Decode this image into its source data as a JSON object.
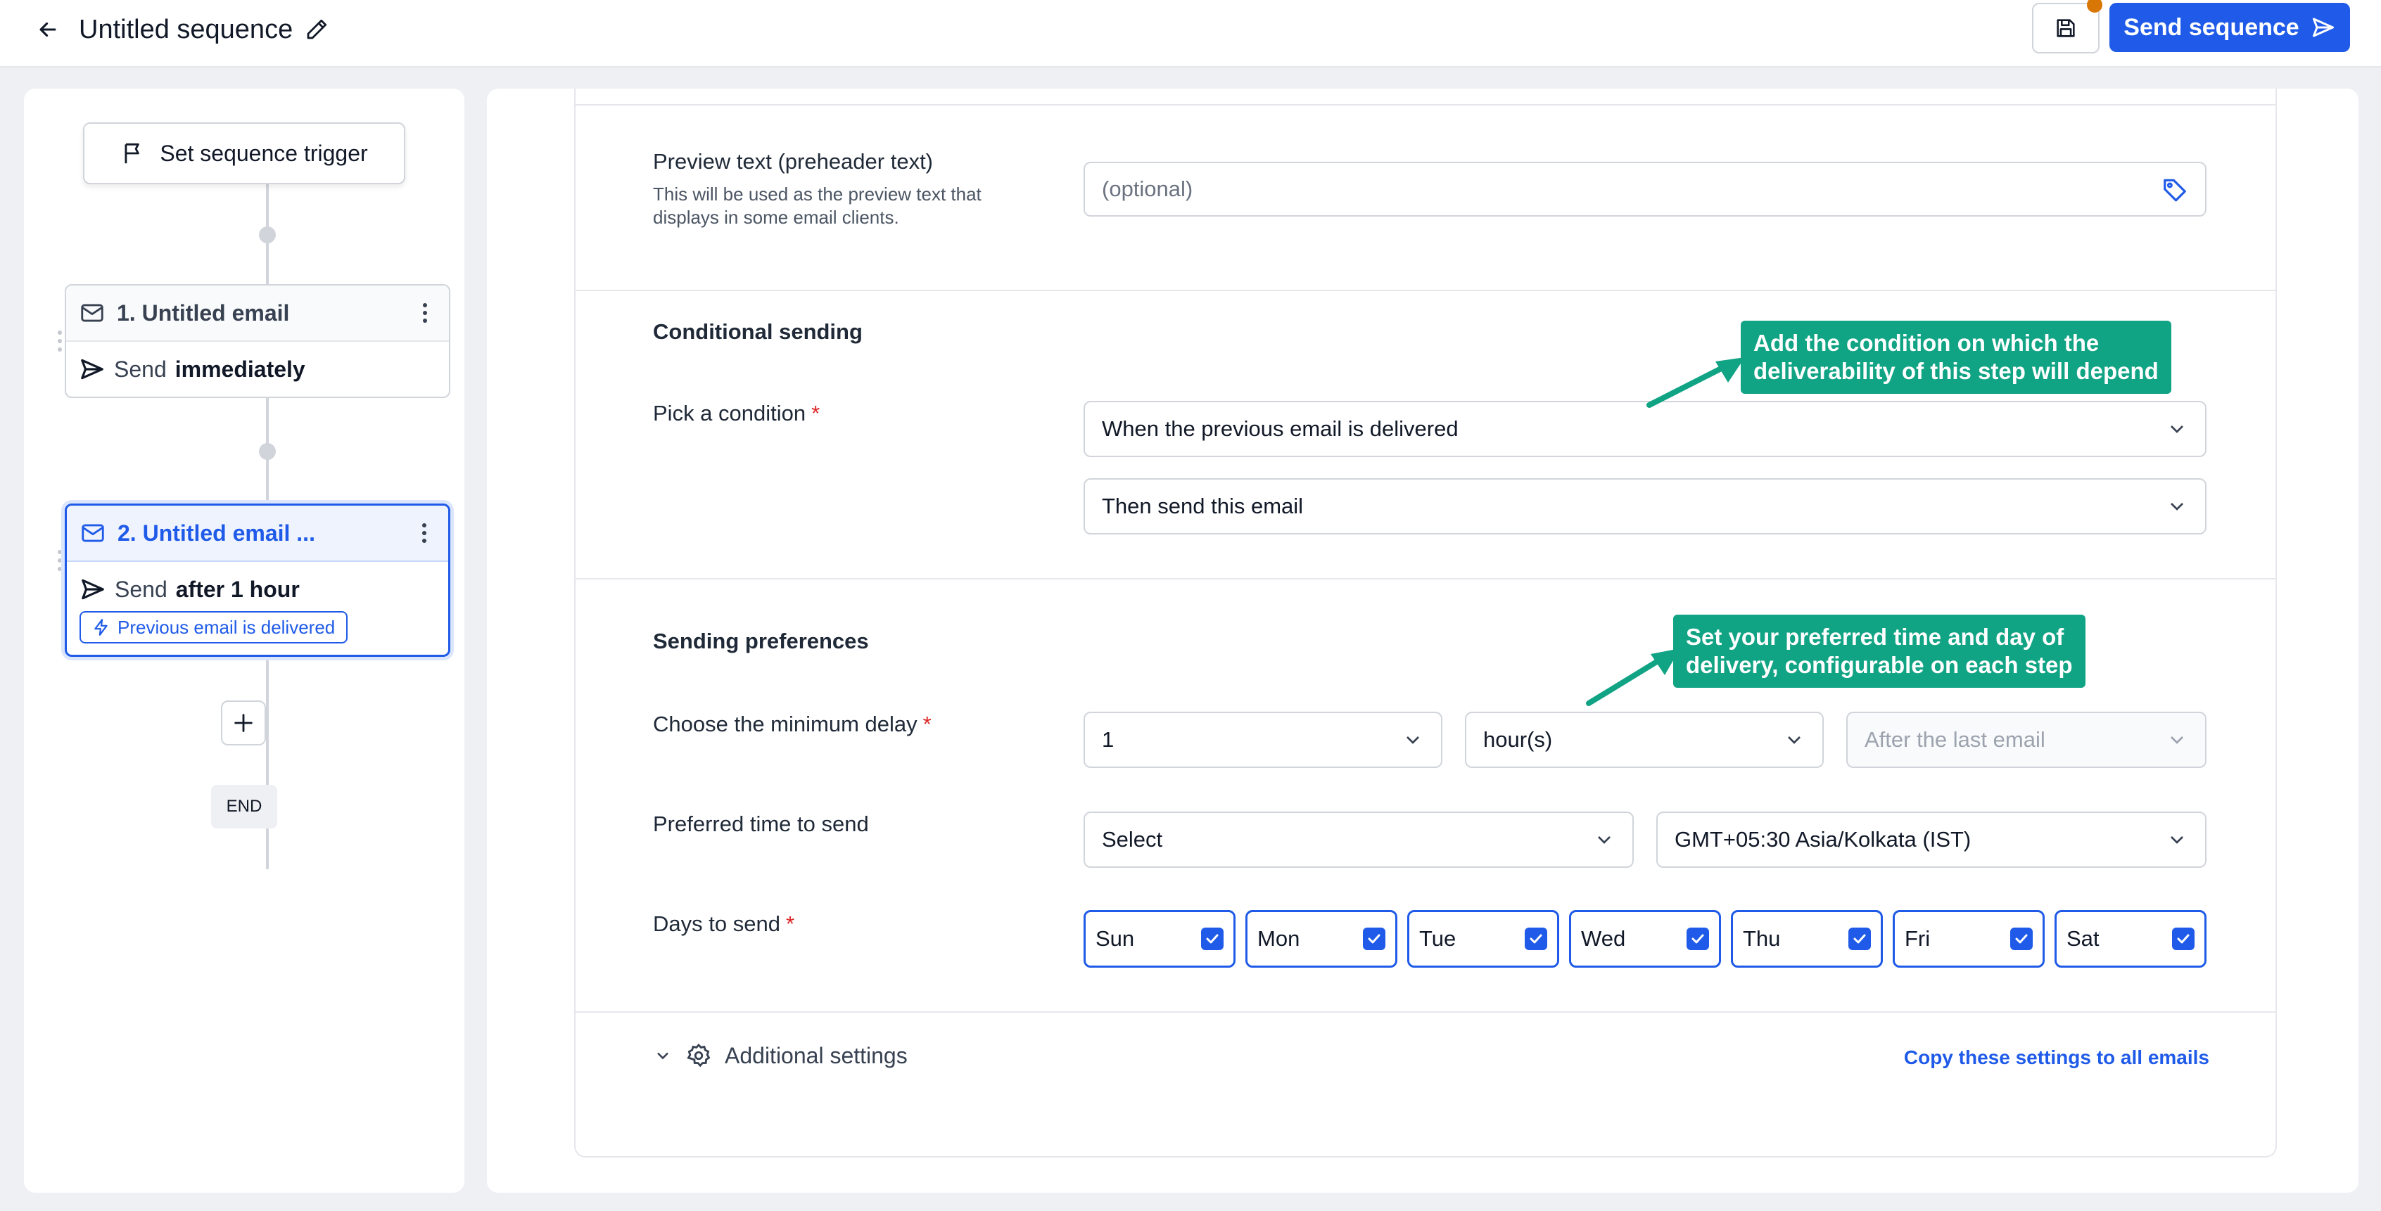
{
  "header": {
    "title": "Untitled sequence",
    "send_label": "Send sequence"
  },
  "flow": {
    "trigger_label": "Set sequence trigger",
    "steps": [
      {
        "title": "1. Untitled email",
        "send_prefix": "Send",
        "send_value": "immediately"
      },
      {
        "title": "2. Untitled email ...",
        "send_prefix": "Send",
        "send_value": "after 1 hour",
        "badge": "Previous email is delivered"
      }
    ],
    "end_label": "END"
  },
  "form": {
    "preview": {
      "label": "Preview text (preheader text)",
      "help": "This will be used as the preview text that displays in some email clients.",
      "placeholder": "(optional)"
    },
    "conditional": {
      "heading": "Conditional sending",
      "label": "Pick a condition",
      "condition_value": "When the previous email is delivered",
      "action_value": "Then send this email"
    },
    "preferences": {
      "heading": "Sending preferences",
      "delay_label": "Choose the minimum delay",
      "delay_value": "1",
      "delay_unit": "hour(s)",
      "delay_reference": "After the last email",
      "time_label": "Preferred time to send",
      "time_value": "Select",
      "timezone_value": "GMT+05:30 Asia/Kolkata (IST)",
      "days_label": "Days to send",
      "days": [
        {
          "label": "Sun",
          "checked": true
        },
        {
          "label": "Mon",
          "checked": true
        },
        {
          "label": "Tue",
          "checked": true
        },
        {
          "label": "Wed",
          "checked": true
        },
        {
          "label": "Thu",
          "checked": true
        },
        {
          "label": "Fri",
          "checked": true
        },
        {
          "label": "Sat",
          "checked": true
        }
      ]
    },
    "additional_settings_label": "Additional settings",
    "copy_settings_label": "Copy these settings to all emails",
    "required_mark": "*"
  },
  "annotations": {
    "condition_tip_line1": "Add the condition on which the",
    "condition_tip_line2": "deliverability of this step will depend",
    "preference_tip_line1": "Set your preferred time and day of",
    "preference_tip_line2": "delivery, configurable on each step"
  },
  "colors": {
    "primary": "#1f5be8",
    "annotation": "#10a384",
    "required": "#dc2626",
    "unsaved_dot": "#d97706"
  }
}
